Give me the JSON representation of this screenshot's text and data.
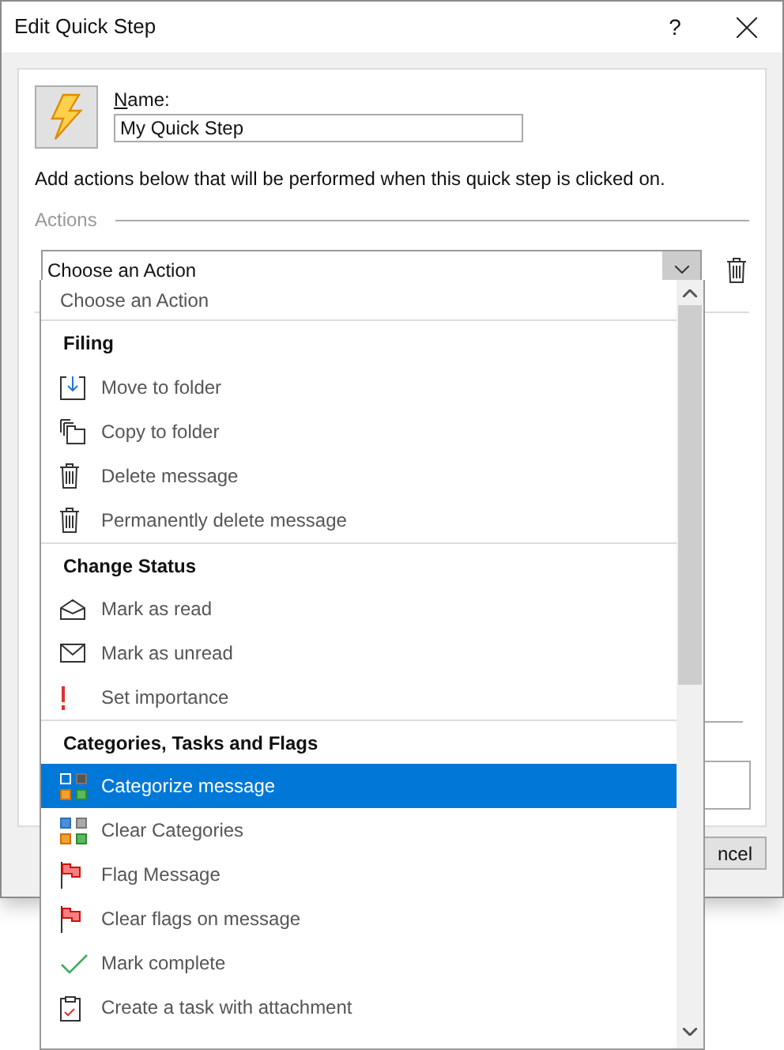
{
  "window": {
    "title": "Edit Quick Step",
    "help": "?"
  },
  "form": {
    "name_label": "Name:",
    "name_value": "My Quick Step",
    "instruction": "Add actions below that will be performed when this quick step is clicked on.",
    "actions_label": "Actions",
    "action_select": "Choose an Action"
  },
  "behind": {
    "button": "ncel"
  },
  "dropdown": {
    "items": [
      {
        "kind": "placeholder",
        "label": "Choose an Action"
      },
      {
        "kind": "header",
        "label": "Filing"
      },
      {
        "kind": "action",
        "label": "Move to folder",
        "selected": false
      },
      {
        "kind": "action",
        "label": "Copy to folder",
        "selected": false
      },
      {
        "kind": "action",
        "label": "Delete message",
        "selected": false
      },
      {
        "kind": "action",
        "label": "Permanently delete message",
        "selected": false
      },
      {
        "kind": "header",
        "label": "Change Status"
      },
      {
        "kind": "action",
        "label": "Mark as read",
        "selected": false
      },
      {
        "kind": "action",
        "label": "Mark as unread",
        "selected": false
      },
      {
        "kind": "action",
        "label": "Set importance",
        "selected": false
      },
      {
        "kind": "header",
        "label": "Categories, Tasks and Flags"
      },
      {
        "kind": "action",
        "label": "Categorize message",
        "selected": true
      },
      {
        "kind": "action",
        "label": "Clear Categories",
        "selected": false
      },
      {
        "kind": "action",
        "label": "Flag Message",
        "selected": false
      },
      {
        "kind": "action",
        "label": "Clear flags on message",
        "selected": false
      },
      {
        "kind": "action",
        "label": "Mark complete",
        "selected": false
      },
      {
        "kind": "action",
        "label": "Create a task with attachment",
        "selected": false
      }
    ]
  }
}
